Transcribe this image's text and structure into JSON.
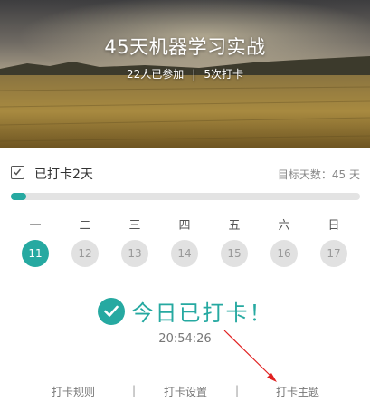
{
  "header": {
    "title": "45天机器学习实战",
    "participants": "22人已参加",
    "separator": "|",
    "checkins": "5次打卡"
  },
  "progress": {
    "checked_label": "已打卡2天",
    "target_label": "目标天数：45 天",
    "fraction": 0.044,
    "accent_color": "#26a9a1"
  },
  "week": {
    "weekdays": [
      "一",
      "二",
      "三",
      "四",
      "五",
      "六",
      "日"
    ],
    "dates": [
      "11",
      "12",
      "13",
      "14",
      "15",
      "16",
      "17"
    ],
    "active_index": 0
  },
  "status": {
    "icon": "check-circle-icon",
    "done_text": "今日已打卡！",
    "time": "20:54:26"
  },
  "footer": {
    "rules": "打卡规则",
    "settings": "打卡设置",
    "topic": "打卡主题",
    "separator": "|"
  }
}
